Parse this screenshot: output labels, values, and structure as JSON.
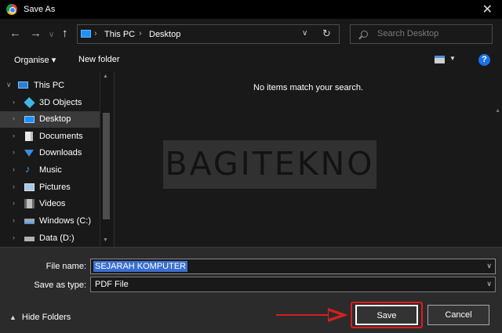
{
  "window": {
    "title": "Save As",
    "icon": "chrome-icon"
  },
  "nav": {
    "back": "←",
    "forward": "→",
    "recent": "∨",
    "up": "↑",
    "breadcrumbs": [
      "This PC",
      "Desktop"
    ],
    "search_placeholder": "Search Desktop"
  },
  "toolbar": {
    "organise": "Organise ▾",
    "new_folder": "New folder",
    "help": "?"
  },
  "sidebar": {
    "items": [
      {
        "label": "This PC",
        "icon": "computer-icon"
      },
      {
        "label": "3D Objects",
        "icon": "cube-icon"
      },
      {
        "label": "Desktop",
        "icon": "desktop-icon",
        "selected": true
      },
      {
        "label": "Documents",
        "icon": "document-icon"
      },
      {
        "label": "Downloads",
        "icon": "download-icon"
      },
      {
        "label": "Music",
        "icon": "music-note-icon"
      },
      {
        "label": "Pictures",
        "icon": "picture-icon"
      },
      {
        "label": "Videos",
        "icon": "film-icon"
      },
      {
        "label": "Windows (C:)",
        "icon": "drive-icon"
      },
      {
        "label": "Data (D:)",
        "icon": "drive-icon"
      }
    ]
  },
  "content": {
    "empty_message": "No items match your search."
  },
  "watermark": "BAGITEKNO",
  "form": {
    "file_name_label": "File name:",
    "file_name_value": "SEJARAH KOMPUTER",
    "save_type_label": "Save as type:",
    "save_type_value": "PDF File"
  },
  "footer": {
    "hide_folders": "Hide Folders",
    "save": "Save",
    "cancel": "Cancel"
  },
  "colors": {
    "accent": "#1e8fff",
    "highlight": "#e01b1b",
    "selection": "#3b6fd1"
  }
}
